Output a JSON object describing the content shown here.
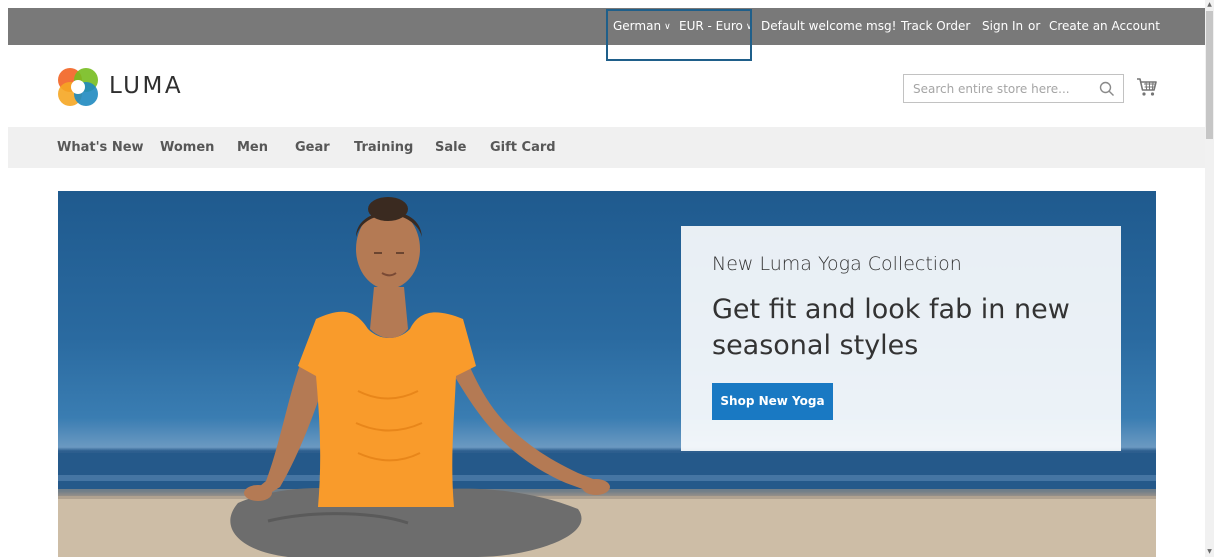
{
  "header": {
    "language": {
      "selected": "German"
    },
    "currency": {
      "selected": "EUR - Euro"
    },
    "welcome": "Default welcome msg!",
    "track_order": "Track Order",
    "sign_in": "Sign In",
    "or": "or",
    "create_account": "Create an Account",
    "bar_color": "#797979",
    "highlight_color": "#1f5f8a"
  },
  "logo": {
    "text": "LUMA",
    "icon": "luma-logo-icon"
  },
  "search": {
    "placeholder": "Search entire store here...",
    "value": "",
    "icon": "search-icon"
  },
  "cart": {
    "icon": "shopping-cart-icon"
  },
  "nav": {
    "items": [
      {
        "label": "What's New"
      },
      {
        "label": "Women"
      },
      {
        "label": "Men"
      },
      {
        "label": "Gear"
      },
      {
        "label": "Training"
      },
      {
        "label": "Sale"
      },
      {
        "label": "Gift Card"
      }
    ]
  },
  "hero": {
    "subtitle": "New Luma Yoga Collection",
    "title": "Get fit and look fab in new seasonal styles",
    "button_label": "Shop New Yoga",
    "button_color": "#1979c3"
  },
  "scrollbar": {
    "up_icon": "scroll-up-arrow-icon",
    "down_icon": "scroll-down-arrow-icon"
  }
}
